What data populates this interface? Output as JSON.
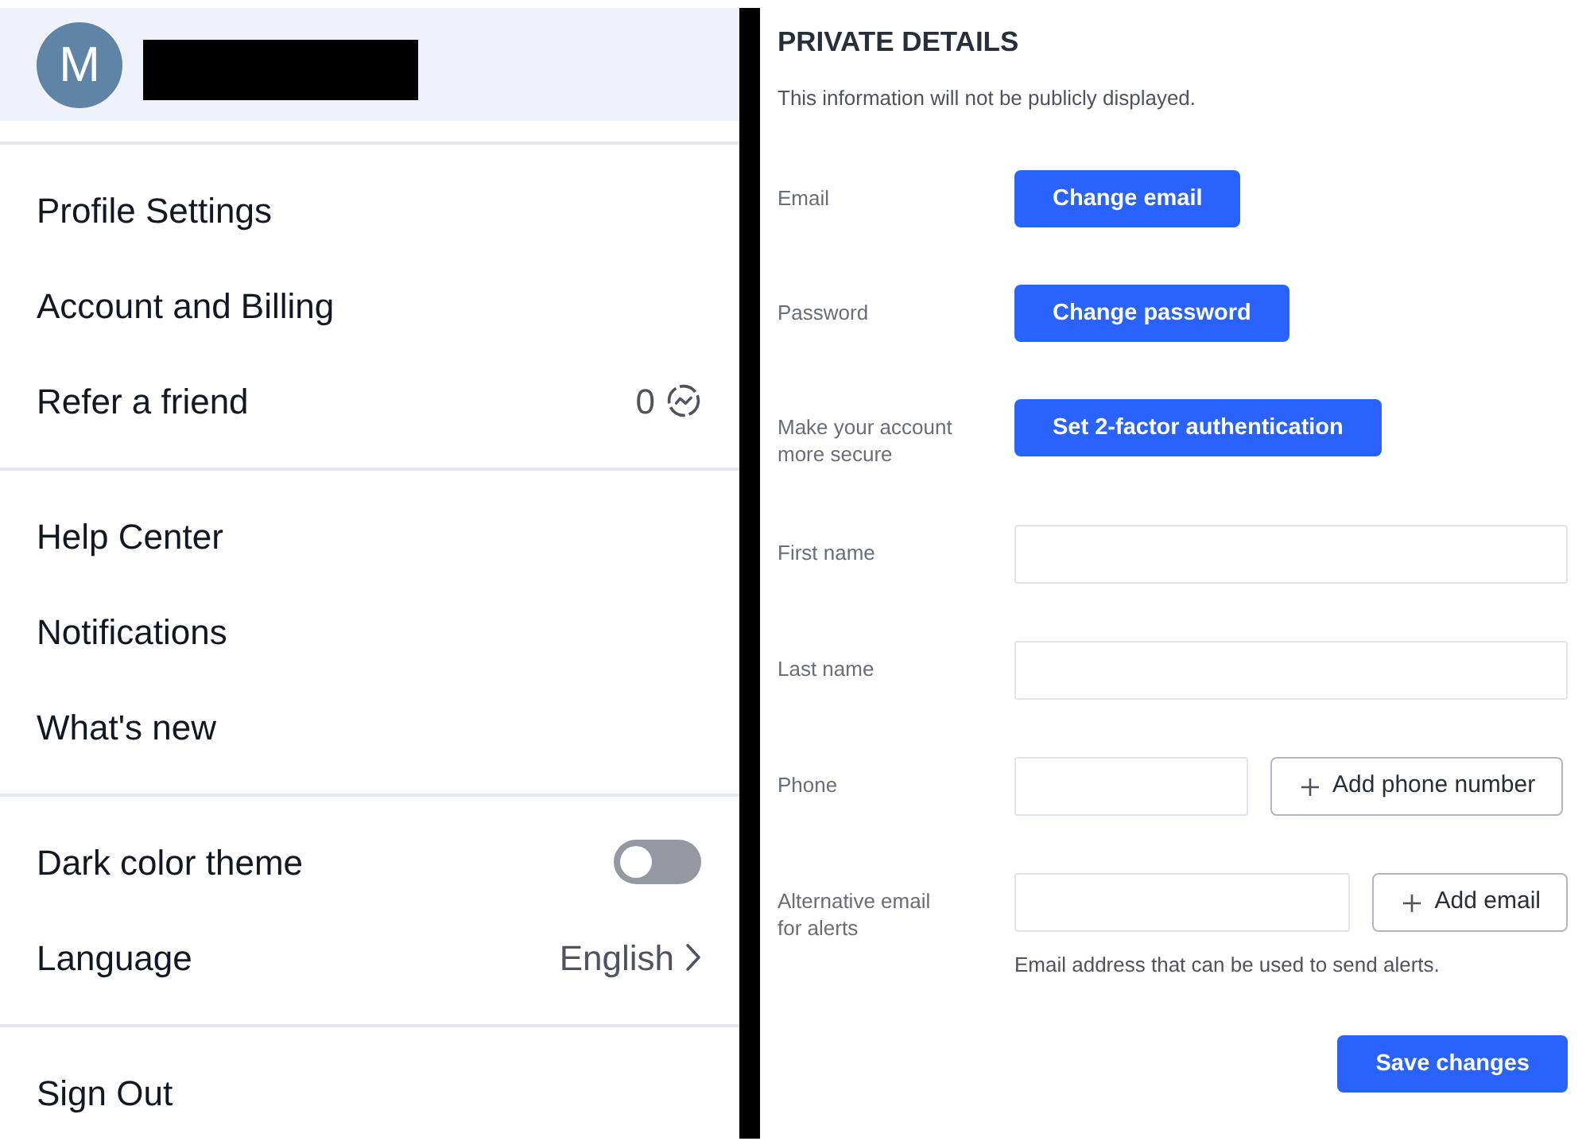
{
  "profile": {
    "avatar_letter": "M"
  },
  "menu_groups": [
    {
      "items": [
        {
          "kind": "link",
          "label": "Profile Settings"
        },
        {
          "kind": "link",
          "label": "Account and Billing"
        },
        {
          "kind": "counter",
          "label": "Refer a friend",
          "count": "0"
        }
      ]
    },
    {
      "items": [
        {
          "kind": "link",
          "label": "Help Center"
        },
        {
          "kind": "link",
          "label": "Notifications"
        },
        {
          "kind": "link",
          "label": "What's new"
        }
      ]
    },
    {
      "items": [
        {
          "kind": "toggle",
          "label": "Dark color theme",
          "on": false
        },
        {
          "kind": "select",
          "label": "Language",
          "value": "English"
        }
      ]
    },
    {
      "items": [
        {
          "kind": "link",
          "label": "Sign Out"
        }
      ]
    }
  ],
  "private_details": {
    "title": "PRIVATE DETAILS",
    "subtitle": "This information will not be publicly displayed.",
    "rows": [
      {
        "kind": "button",
        "label": "Email",
        "button": "Change email"
      },
      {
        "kind": "button",
        "label": "Password",
        "button": "Change password"
      },
      {
        "kind": "button",
        "label": "Make your account more secure",
        "button": "Set 2-factor authentication"
      },
      {
        "kind": "input",
        "label": "First name"
      },
      {
        "kind": "input",
        "label": "Last name"
      },
      {
        "kind": "input_action",
        "label": "Phone",
        "action": "Add phone number"
      },
      {
        "kind": "input_action",
        "label": "Alternative email for alerts",
        "action": "Add email",
        "help": "Email address that can be used to send alerts."
      }
    ],
    "save_button": "Save changes"
  }
}
